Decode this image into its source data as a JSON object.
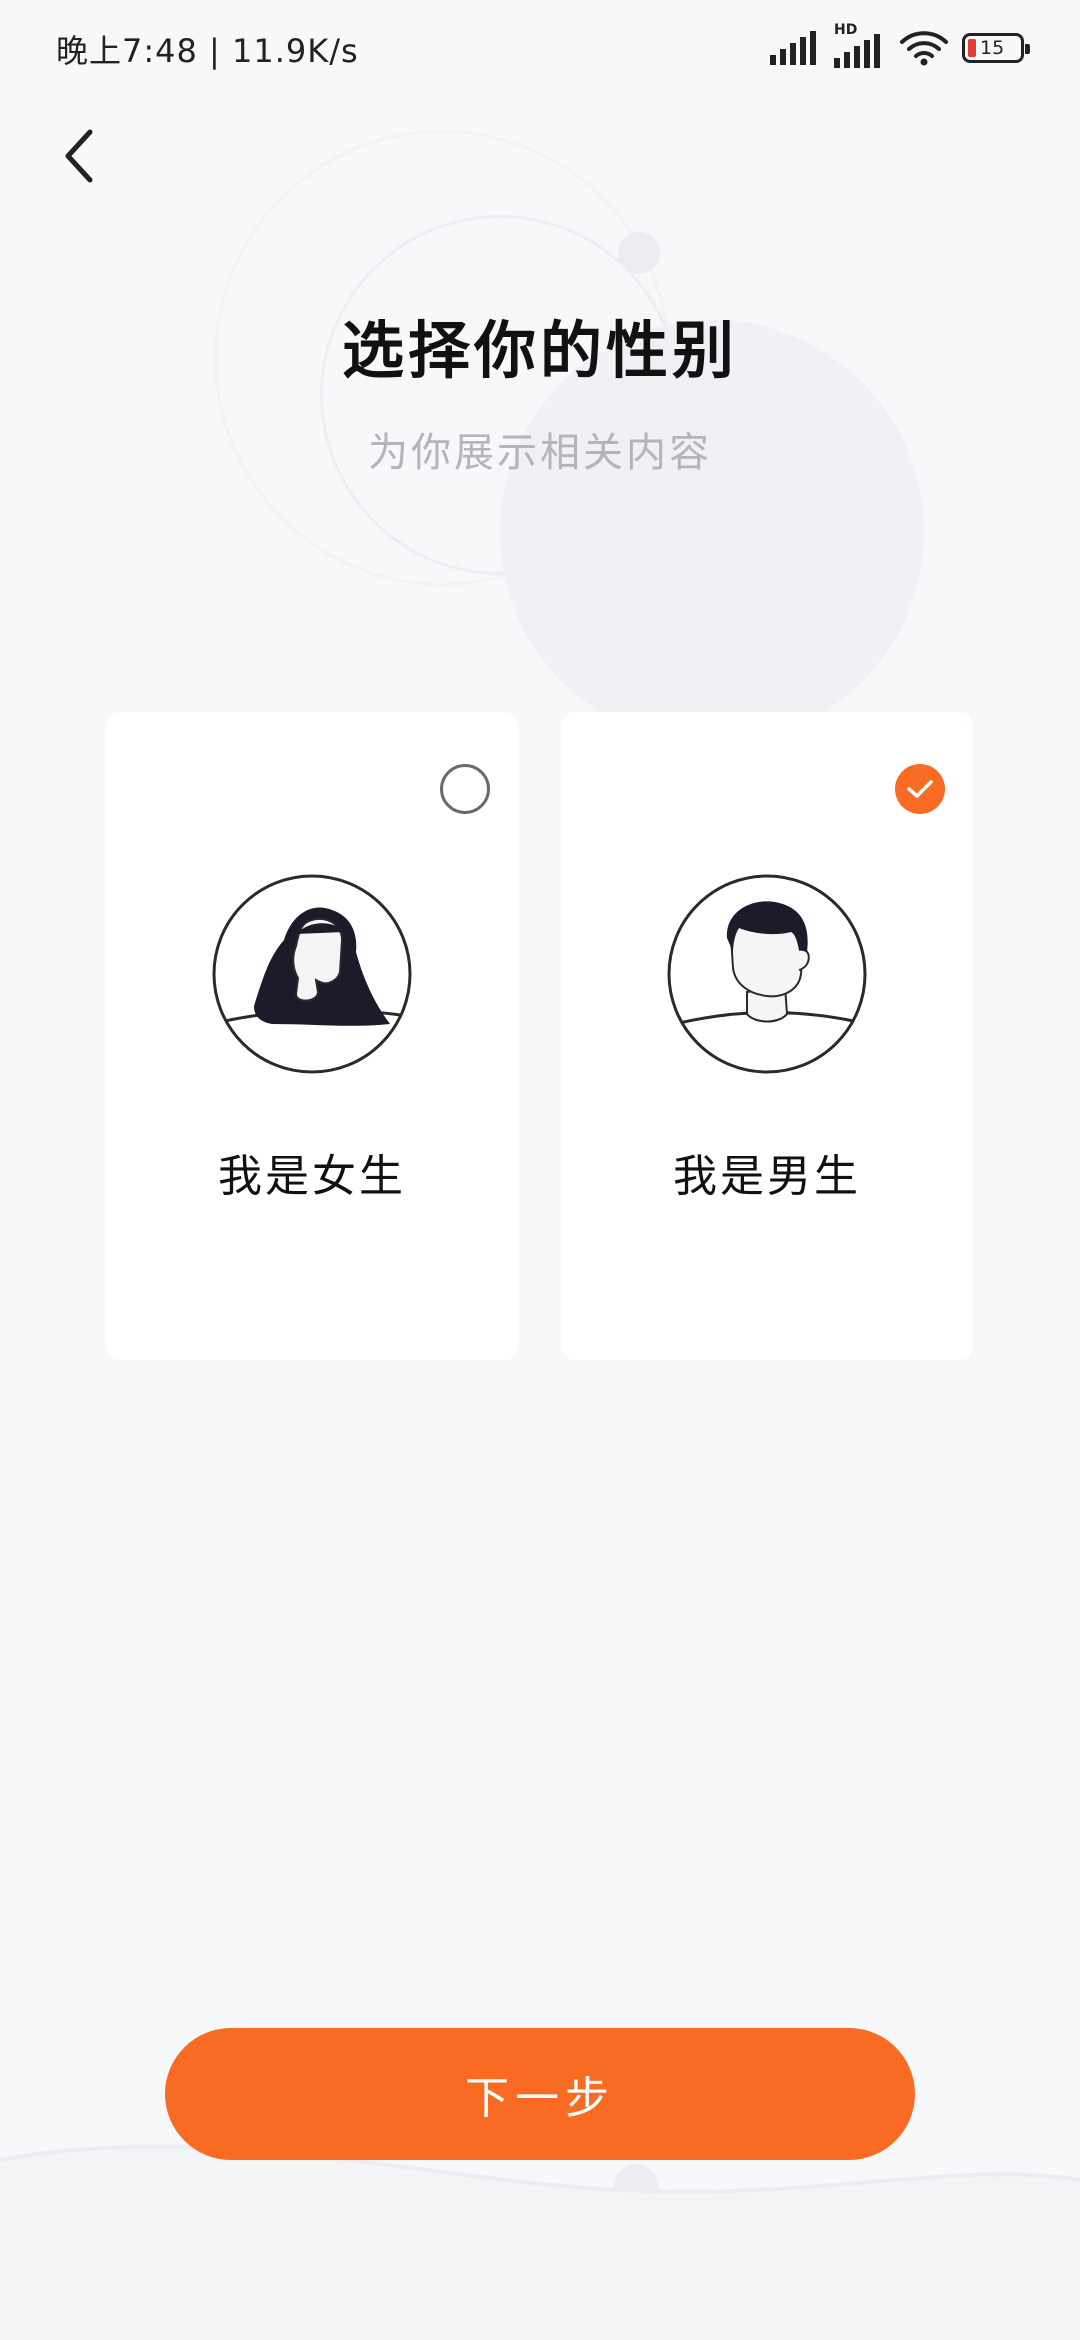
{
  "status_bar": {
    "time_speed": "晚上7:48 | 11.9K/s",
    "network_label": "HD",
    "battery_level": "15",
    "battery_color": "#e53935"
  },
  "header": {
    "back_icon": "chevron-left-icon",
    "title": "选择你的性别",
    "subtitle": "为你展示相关内容"
  },
  "options": [
    {
      "label": "我是女生",
      "selected": false,
      "avatar_icon": "female-avatar-icon"
    },
    {
      "label": "我是男生",
      "selected": true,
      "avatar_icon": "male-avatar-icon"
    }
  ],
  "actions": {
    "next_label": "下一步"
  },
  "colors": {
    "accent": "#f96a23",
    "background": "#f7f8fa",
    "card": "#ffffff",
    "title": "#111111",
    "subtitle": "#b3b5ba"
  }
}
